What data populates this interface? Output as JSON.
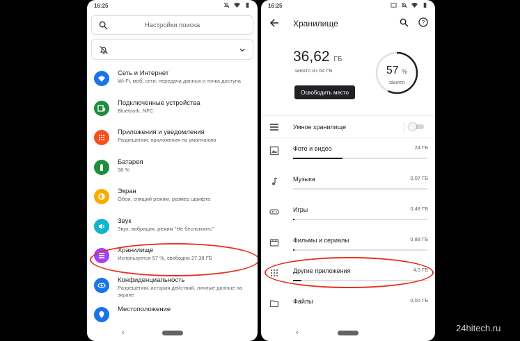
{
  "left": {
    "status_time": "16:25",
    "search_placeholder": "Настройки поиска",
    "items": [
      {
        "title": "Сеть и Интернет",
        "sub": "Wi-Fi, моб. сети, передача данных и точка доступа",
        "color": "#1a73e8",
        "icon": "wifi-icon"
      },
      {
        "title": "Подключенные устройства",
        "sub": "Bluetooth, NFC",
        "color": "#1e8e3e",
        "icon": "devices-icon"
      },
      {
        "title": "Приложения и уведомления",
        "sub": "Разрешения, приложения по умолчанию",
        "color": "#f4511e",
        "icon": "apps-icon"
      },
      {
        "title": "Батарея",
        "sub": "98 %",
        "color": "#1e8e3e",
        "icon": "battery-icon"
      },
      {
        "title": "Экран",
        "sub": "Обои, спящий режим, размер шрифта",
        "color": "#f9ab00",
        "icon": "display-icon"
      },
      {
        "title": "Звук",
        "sub": "Звук, вибрация, режим \"Не беспокоить\"",
        "color": "#12b5cb",
        "icon": "sound-icon"
      },
      {
        "title": "Хранилище",
        "sub": "Используется 57 %, свободно 27,38 ГБ",
        "color": "#a142f4",
        "icon": "storage-icon"
      },
      {
        "title": "Конфиденциальность",
        "sub": "Разрешения, история действий, личные данные на экране",
        "color": "#1a73e8",
        "icon": "privacy-icon"
      },
      {
        "title": "Местоположение",
        "sub": "",
        "color": "#1a73e8",
        "icon": "location-icon"
      }
    ]
  },
  "right": {
    "status_time": "16:25",
    "title": "Хранилище",
    "used_value": "36,62",
    "used_unit": "ГБ",
    "used_sub": "занято из 64 ГБ",
    "free_button": "Освободить место",
    "percent_value": "57",
    "percent_unit": "%",
    "percent_label": "занято",
    "percent_fraction": 0.57,
    "smart_storage": "Умное хранилище",
    "categories": [
      {
        "label": "Фото и видео",
        "size": "24 ГБ",
        "fill": 0.37,
        "icon": "photo-icon"
      },
      {
        "label": "Музыка",
        "size": "0,07 ГБ",
        "fill": 0.0,
        "icon": "music-icon"
      },
      {
        "label": "Игры",
        "size": "0,48 ГБ",
        "fill": 0.01,
        "icon": "games-icon"
      },
      {
        "label": "Фильмы и сериалы",
        "size": "0,88 ГБ",
        "fill": 0.01,
        "icon": "movies-icon"
      },
      {
        "label": "Другие приложения",
        "size": "4,0 ГБ",
        "fill": 0.06,
        "icon": "apps-grid-icon"
      },
      {
        "label": "Файлы",
        "size": "0,00 ГБ",
        "fill": 0.0,
        "icon": "folder-icon"
      }
    ]
  },
  "watermark": "24hitech.ru",
  "colors": {
    "highlight": "#e8311f"
  }
}
